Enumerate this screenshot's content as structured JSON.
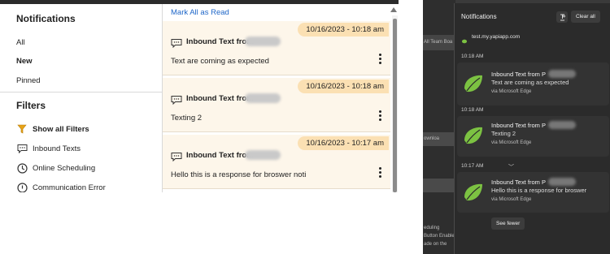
{
  "left": {
    "sidebar": {
      "notifications_title": "Notifications",
      "items": [
        {
          "label": "All"
        },
        {
          "label": "New"
        },
        {
          "label": "Pinned"
        }
      ],
      "filters_title": "Filters",
      "filters": [
        {
          "label": "Show all Filters",
          "icon": "filter-icon"
        },
        {
          "label": "Inbound Texts",
          "icon": "message-icon"
        },
        {
          "label": "Online Scheduling",
          "icon": "clock-icon"
        },
        {
          "label": "Communication Error",
          "icon": "error-icon"
        }
      ]
    },
    "list": {
      "mark_all_label": "Mark All as Read",
      "cards": [
        {
          "date": "10/16/2023 - 10:18 am",
          "title": "Inbound Text from",
          "message": "Text are coming as expected"
        },
        {
          "date": "10/16/2023 - 10:18 am",
          "title": "Inbound Text from",
          "message": "Texting 2"
        },
        {
          "date": "10/16/2023 - 10:17 am",
          "title": "Inbound Text from",
          "message": "Hello this is a response for broswer noti"
        }
      ]
    },
    "colors": {
      "card_bg": "#fdf6ea",
      "date_chip": "#fbe0b3",
      "link": "#1e66c8"
    }
  },
  "windows": {
    "background_app": {
      "tab_label": "All Team Boa",
      "chip_label": "ownloa",
      "bottom_lines": [
        "eduling",
        "Button Enable",
        "ade on the "
      ]
    },
    "pane_title": "Notifications",
    "clear_all_label": "Clear all",
    "site": "test.my.yapiapp.com",
    "groups": [
      {
        "time": "10:18 AM",
        "title": "Inbound Text from  P",
        "message": "Text are coming as expected",
        "via": "via Microsoft Edge"
      },
      {
        "time": "10:18 AM",
        "title": "Inbound Text from  P",
        "message": "Texting 2",
        "via": "via Microsoft Edge"
      },
      {
        "time": "10:17 AM",
        "title": "Inbound Text from  P",
        "message": "Hello this is a response for broswer",
        "via": "via Microsoft Edge"
      }
    ],
    "see_fewer_label": "See fewer",
    "colors": {
      "pane_bg": "#2b2b2b",
      "card_bg": "#333333",
      "leaf_green": "#7cc242"
    }
  }
}
